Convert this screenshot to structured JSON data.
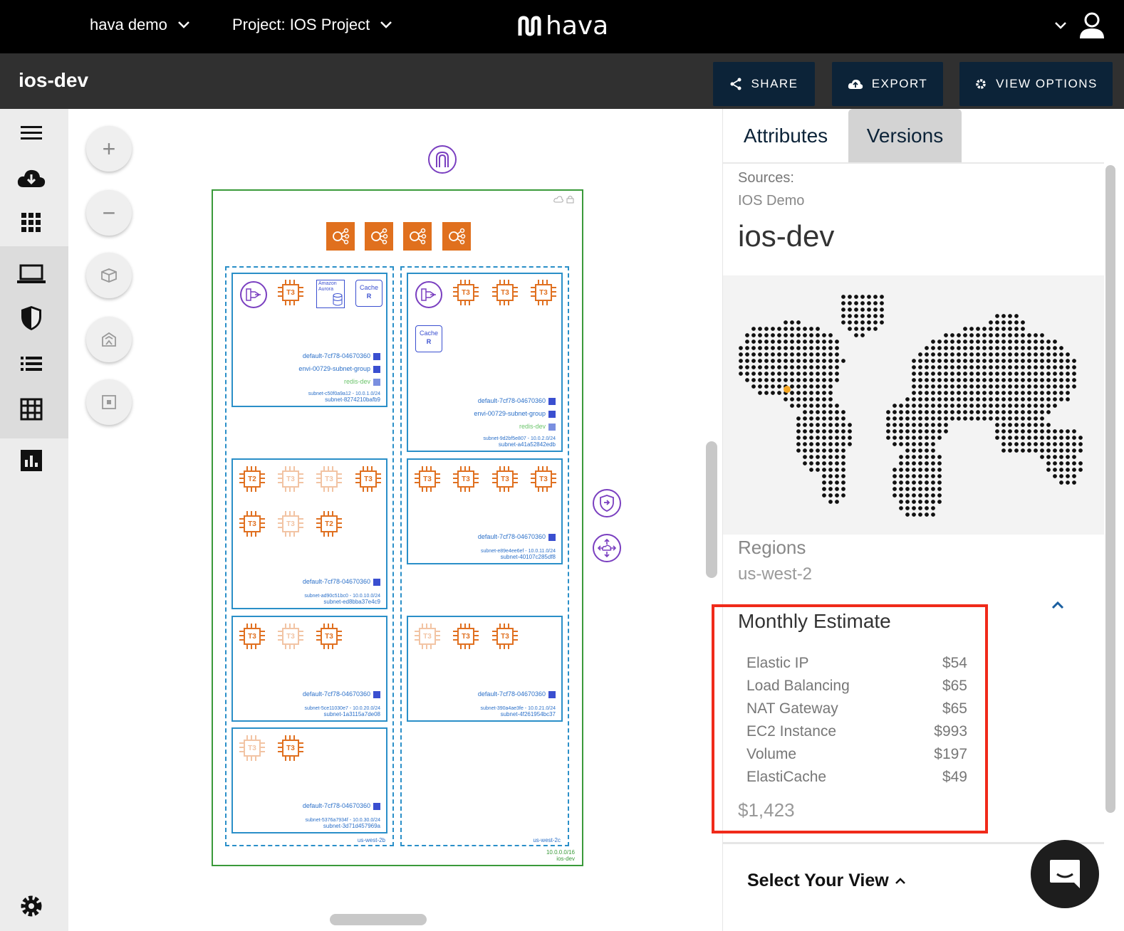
{
  "topbar": {
    "account": "hava demo",
    "project": "Project: IOS Project",
    "logo": "hava"
  },
  "subbar": {
    "title": "ios-dev",
    "share": "SHARE",
    "export": "EXPORT",
    "view_options": "VIEW OPTIONS"
  },
  "leftnav": [
    "hamburger-icon",
    "cloud-download-icon",
    "apps-grid-icon",
    "laptop-icon",
    "shield-icon",
    "list-icon",
    "table-icon",
    "bar-chart-icon",
    "gear-icon"
  ],
  "diagram": {
    "vpc_cidr": "10.0.0.0/16",
    "vpc_name": "ios-dev",
    "az_left": "us-west-2b",
    "az_right": "us-west-2c",
    "aurora_label": "Amazon Aurora",
    "cache_label": "Cache",
    "cache_r": "R",
    "s1": {
      "sg1": "default-7cf78-04670360",
      "sg2": "envi-00729-subnet-group",
      "sg3": "redis-dev",
      "id1": "subnet-c50f0a9a12 - 10.0.1.0/24",
      "id2": "subnet-8274210bafb9"
    },
    "s2": {
      "sg1": "default-7cf78-04670360",
      "sg2": "envi-00729-subnet-group",
      "sg3": "redis-dev",
      "id1": "subnet-9d2bf5e807 - 10.0.2.0/24",
      "id2": "subnet-a41a52842edb"
    },
    "s3": {
      "sg1": "default-7cf78-04670360",
      "id1": "subnet-ad90c51bc0 - 10.0.10.0/24",
      "id2": "subnet-ed8bba37e4c9"
    },
    "s4": {
      "sg1": "default-7cf78-04670360",
      "id1": "subnet-e89e4ee6ef - 10.0.11.0/24",
      "id2": "subnet-40107c285df8"
    },
    "s5": {
      "sg1": "default-7cf78-04670360",
      "id1": "subnet-5ce11030e7 - 10.0.20.0/24",
      "id2": "subnet-1a3115a7de08"
    },
    "s6": {
      "sg1": "default-7cf78-04670360",
      "id1": "subnet-390a4ae3fe - 10.0.21.0/24",
      "id2": "subnet-4f261954bc37"
    },
    "s7": {
      "sg1": "default-7cf78-04670360",
      "id1": "subnet-5376a7934f - 10.0.30.0/24",
      "id2": "subnet-3d71d457969a"
    }
  },
  "panel": {
    "tab_attributes": "Attributes",
    "tab_versions": "Versions",
    "sources_label": "Sources:",
    "sources_value": "IOS Demo",
    "name": "ios-dev",
    "regions_label": "Regions",
    "regions_value": "us-west-2",
    "estimate_title": "Monthly Estimate",
    "estimate": [
      {
        "name": "Elastic IP",
        "cost": "$54"
      },
      {
        "name": "Load Balancing",
        "cost": "$65"
      },
      {
        "name": "NAT Gateway",
        "cost": "$65"
      },
      {
        "name": "EC2 Instance",
        "cost": "$993"
      },
      {
        "name": "Volume",
        "cost": "$197"
      },
      {
        "name": "ElastiCache",
        "cost": "$49"
      }
    ],
    "total": "$1,423",
    "select_view": "Select Your View"
  },
  "colors": {
    "accent_navy": "#0c2338",
    "aws_orange": "#e07020",
    "subnet_blue": "#2a8fc8",
    "vpc_green": "#3a9a3a",
    "highlight_red": "#f02a1a",
    "marker_orange": "#f5a623"
  }
}
